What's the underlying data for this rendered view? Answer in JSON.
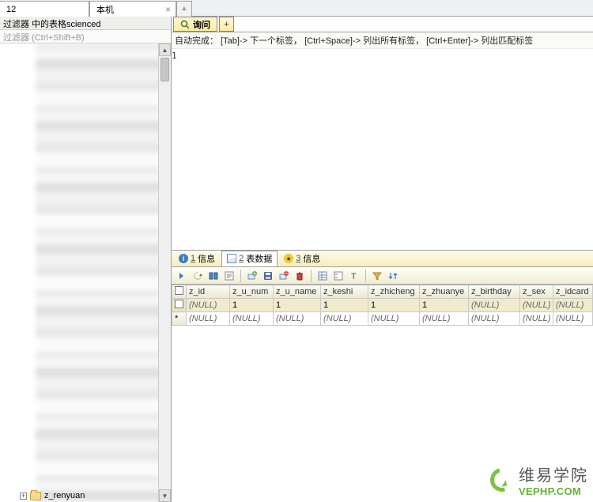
{
  "top": {
    "input_value": "12",
    "tab_label": "本机",
    "add_label": "+"
  },
  "filter": {
    "header": "过滤器 中的表格scienced",
    "hint": "过滤器 (Ctrl+Shift+B)"
  },
  "tree": {
    "bottom_item": "z_renyuan"
  },
  "query": {
    "tab_label": "询问",
    "add_label": "+",
    "hint": "自动完成： [Tab]-> 下一个标签， [Ctrl+Space]-> 列出所有标签， [Ctrl+Enter]-> 列出匹配标签",
    "line_no": "1"
  },
  "result_tabs": {
    "t1": "信息",
    "t1n": "1",
    "t2": "表数据",
    "t2n": "2",
    "t3": "信息",
    "t3n": "3",
    "faded": ""
  },
  "columns": [
    "z_id",
    "z_u_num",
    "z_u_name",
    "z_keshi",
    "z_zhicheng",
    "z_zhuanye",
    "z_birthday",
    "z_sex",
    "z_idcard"
  ],
  "rows": [
    {
      "sel": true,
      "mark": "☐",
      "cells": [
        "(NULL)",
        "1",
        "1",
        "1",
        "1",
        "1",
        "(NULL)",
        "(NULL)",
        "(NULL)"
      ]
    },
    {
      "sel": false,
      "mark": "*",
      "cells": [
        "(NULL)",
        "(NULL)",
        "(NULL)",
        "(NULL)",
        "(NULL)",
        "(NULL)",
        "(NULL)",
        "(NULL)",
        "(NULL)"
      ]
    }
  ],
  "watermark": {
    "line1": "维易学院",
    "line2": "VEPHP.COM"
  }
}
